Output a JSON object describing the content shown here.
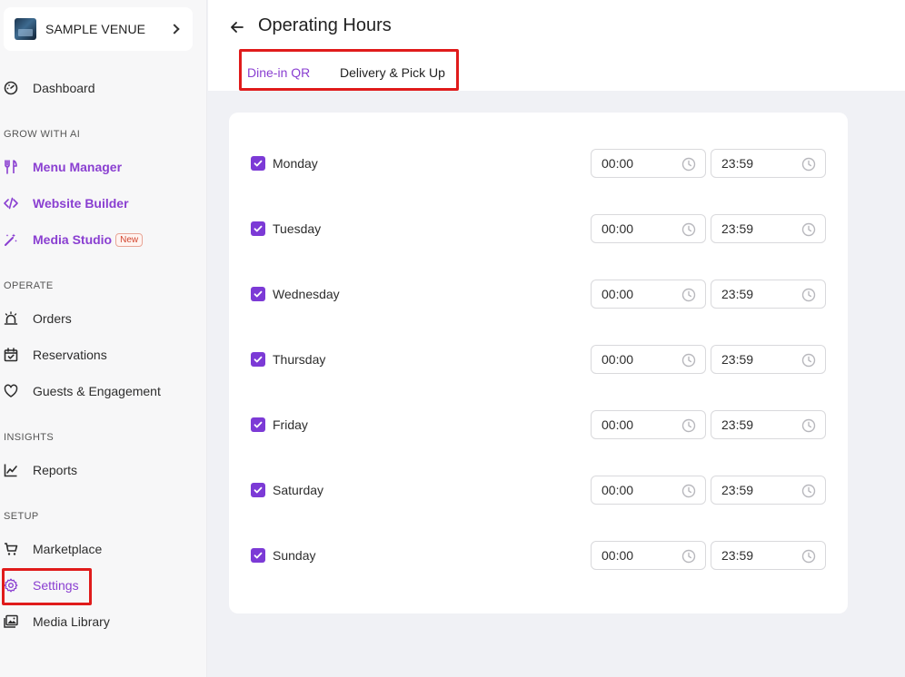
{
  "venue": {
    "name": "SAMPLE VENUE"
  },
  "sidebar": {
    "dashboard": "Dashboard",
    "sections": {
      "grow": "GROW WITH AI",
      "operate": "OPERATE",
      "insights": "INSIGHTS",
      "setup": "SETUP"
    },
    "items": {
      "menu_manager": "Menu Manager",
      "website_builder": "Website Builder",
      "media_studio": "Media Studio",
      "media_studio_badge": "New",
      "orders": "Orders",
      "reservations": "Reservations",
      "guests": "Guests & Engagement",
      "reports": "Reports",
      "marketplace": "Marketplace",
      "settings": "Settings",
      "media_library": "Media Library"
    }
  },
  "header": {
    "title": "Operating Hours"
  },
  "tabs": [
    {
      "label": "Dine-in QR",
      "active": true
    },
    {
      "label": "Delivery & Pick Up",
      "active": false
    }
  ],
  "schedule": [
    {
      "day": "Monday",
      "enabled": true,
      "open": "00:00",
      "close": "23:59"
    },
    {
      "day": "Tuesday",
      "enabled": true,
      "open": "00:00",
      "close": "23:59"
    },
    {
      "day": "Wednesday",
      "enabled": true,
      "open": "00:00",
      "close": "23:59"
    },
    {
      "day": "Thursday",
      "enabled": true,
      "open": "00:00",
      "close": "23:59"
    },
    {
      "day": "Friday",
      "enabled": true,
      "open": "00:00",
      "close": "23:59"
    },
    {
      "day": "Saturday",
      "enabled": true,
      "open": "00:00",
      "close": "23:59"
    },
    {
      "day": "Sunday",
      "enabled": true,
      "open": "00:00",
      "close": "23:59"
    }
  ],
  "colors": {
    "accent": "#8a3fd1",
    "checkbox": "#7c3ad6",
    "highlight": "#e01b1b",
    "badge": "#d2452e"
  },
  "icons": {
    "venue_chevron": "chevron-right-icon",
    "dashboard": "gauge-icon",
    "menu_manager": "utensils-icon",
    "website_builder": "code-icon",
    "media_studio": "magic-wand-icon",
    "orders": "alarm-bell-icon",
    "reservations": "calendar-check-icon",
    "guests": "heart-icon",
    "reports": "line-chart-icon",
    "marketplace": "cart-icon",
    "settings": "gear-icon",
    "media_library": "images-icon",
    "back": "arrow-left-icon",
    "time": "clock-icon",
    "checkbox": "check-icon"
  }
}
